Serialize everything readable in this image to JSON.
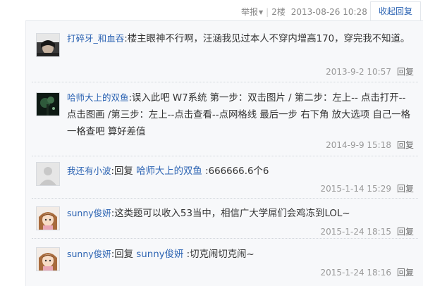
{
  "top": {
    "report_label": "举报",
    "floor": "2楼",
    "datetime": "2013-08-26 10:28",
    "collapse_label": "收起回复"
  },
  "replies": [
    {
      "user": "打碎牙_和血吞",
      "colon": ":",
      "text": "楼主眼神不行啊，汪涵我见过本人不穿内增高170，穿完我不知道。",
      "date": "2013-9-2 10:57",
      "reply_label": "回复",
      "avatar": "dark-portrait-avatar"
    },
    {
      "user": "哈师大上的双鱼",
      "colon": ":",
      "text": "误入此吧 W7系统 第一步：双击图片 / 第二步：左上-- 点击打开--点击图画 /第三步：左上--点击查看--点网格线 最后一步 右下角 放大选项 自己一格一格查吧 算好差值",
      "date": "2014-9-9 15:18",
      "reply_label": "回复",
      "avatar": "dark-tree-avatar"
    },
    {
      "user": "我还有小波",
      "colon": ":",
      "prefix": "回复 ",
      "target": "哈师大上的双鱼",
      "text": " :666666.6个6",
      "date": "2015-1-14 15:29",
      "reply_label": "回复",
      "avatar": "default-gray-avatar"
    },
    {
      "user": "sunny俊妍",
      "colon": ":",
      "text": "这类题可以收入53当中，相信广大学屌们会鸡冻到LOL~",
      "date": "2015-1-24 18:15",
      "reply_label": "回复",
      "avatar": "anime-girl-avatar"
    },
    {
      "user": "sunny俊妍",
      "colon": ":",
      "prefix": "回复 ",
      "target": "sunny俊妍",
      "text": " :切克闹切克闹~",
      "date": "2015-1-24 18:16",
      "reply_label": "回复",
      "avatar": "anime-girl-avatar"
    }
  ],
  "colors": {
    "link_blue": "#2d64b3",
    "panel_bg": "#f7f8fa",
    "meta_gray": "#999999"
  }
}
